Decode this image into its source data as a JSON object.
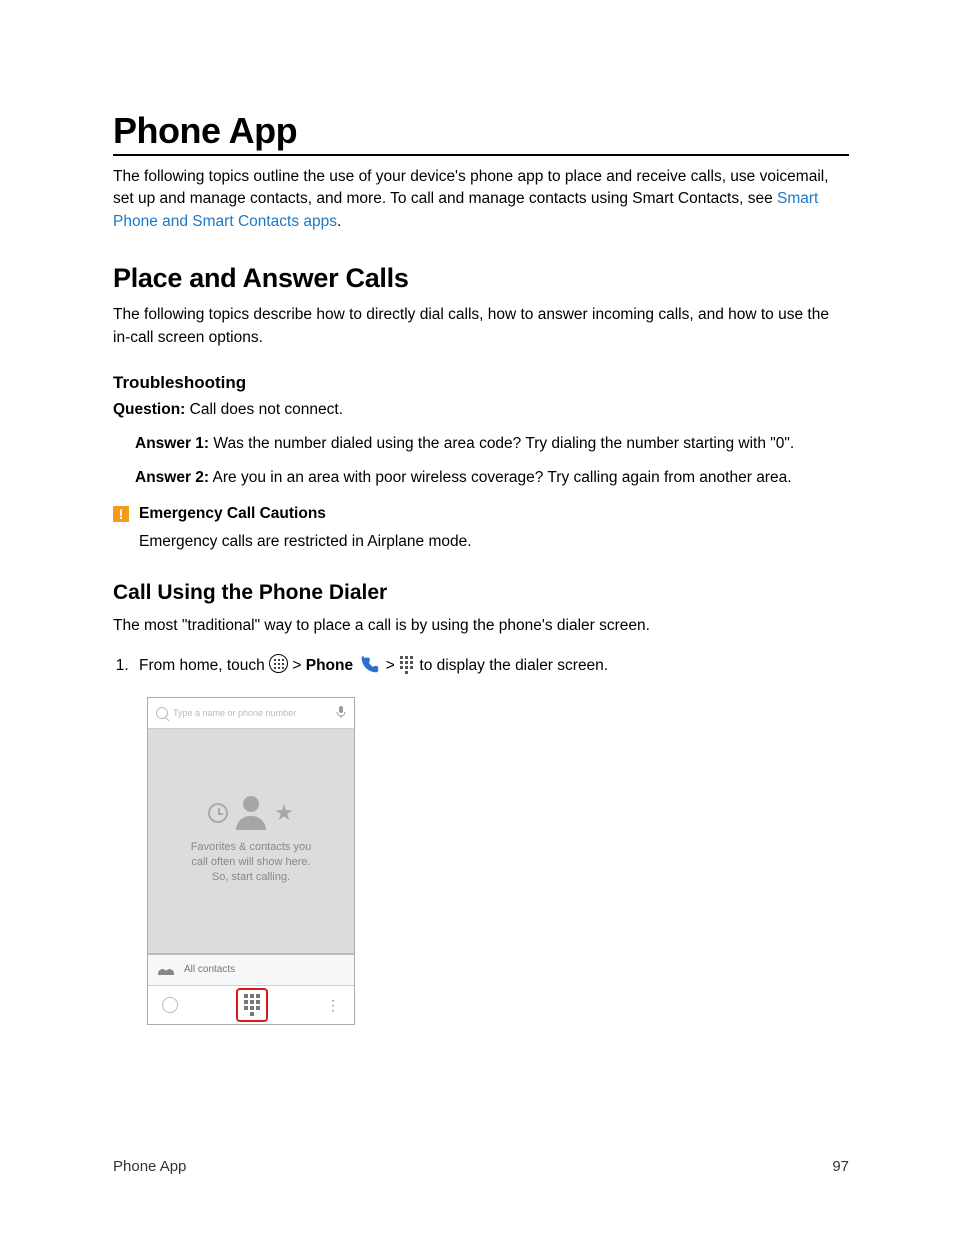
{
  "title": "Phone App",
  "intro_pre": "The following topics outline the use of your device's phone app to place and receive calls, use voicemail, set up and manage contacts, and more. To call and manage contacts using Smart Contacts, see ",
  "intro_link": "Smart Phone and Smart Contacts apps",
  "intro_post": ".",
  "section1": {
    "heading": "Place and Answer Calls",
    "body": "The following topics describe how to directly dial calls, how to answer incoming calls, and how to use the in-call screen options.",
    "troubleshooting_heading": "Troubleshooting",
    "question_label": "Question:",
    "question_text": " Call does not connect.",
    "answer1_label": "Answer 1:",
    "answer1_text": " Was the number dialed using the area code? Try dialing the number starting with \"0\".",
    "answer2_label": "Answer 2:",
    "answer2_text": " Are you in an area with poor wireless coverage? Try calling again from another area.",
    "caution_title": "Emergency Call Cautions",
    "caution_body": "Emergency calls are restricted in Airplane mode."
  },
  "section2": {
    "heading": "Call Using the Phone Dialer",
    "body": "The most \"traditional\" way to place a call is by using the phone's dialer screen.",
    "step1_pre": "From home, touch ",
    "step1_gt1": " > ",
    "step1_phone": "Phone",
    "step1_gt2": " > ",
    "step1_post": " to display the dialer screen."
  },
  "mock": {
    "search_placeholder": "Type a name or phone number",
    "center_line1": "Favorites & contacts you",
    "center_line2": "call often will show here.",
    "center_line3": "So, start calling.",
    "all_contacts": "All contacts"
  },
  "footer": {
    "left": "Phone App",
    "right": "97"
  }
}
